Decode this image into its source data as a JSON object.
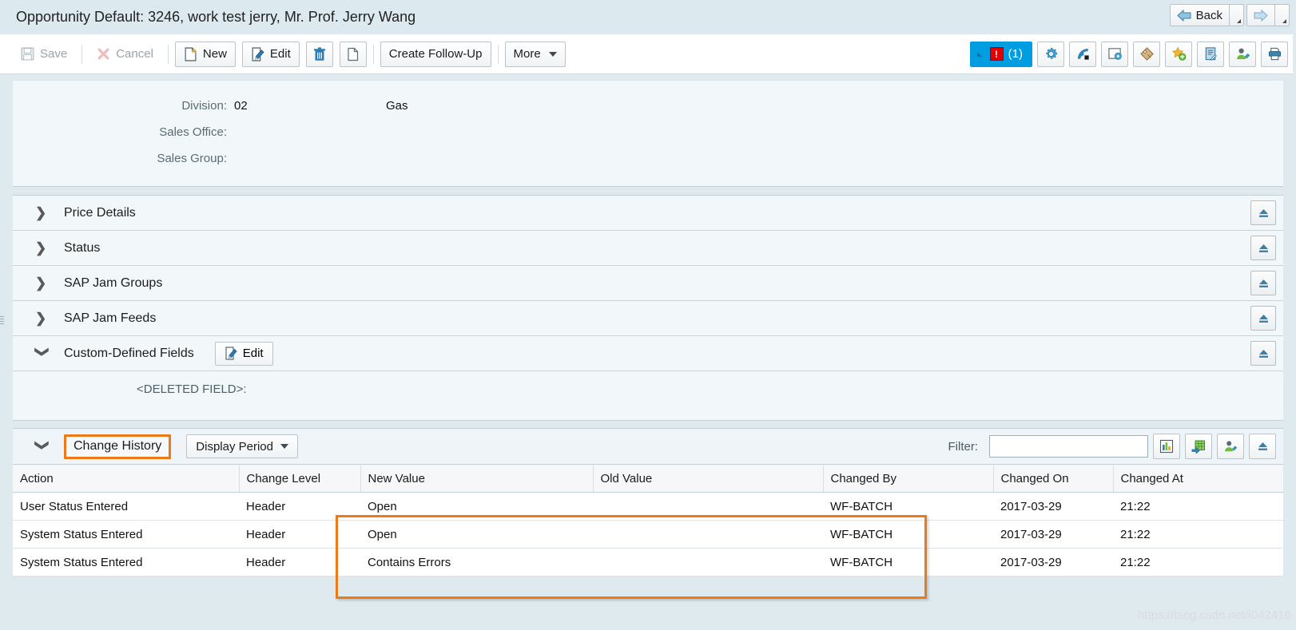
{
  "window": {
    "title": "Opportunity Default: 3246, work test jerry, Mr. Prof. Jerry Wang",
    "back_label": "Back"
  },
  "toolbar": {
    "save_label": "Save",
    "cancel_label": "Cancel",
    "new_label": "New",
    "edit_label": "Edit",
    "delete_icon": "trash-icon",
    "copy_icon": "copy-icon",
    "create_follow_up_label": "Create Follow-Up",
    "more_label": "More",
    "message_count": "(1)",
    "message_badge": "!",
    "right_icons": [
      "personalize-gear-icon",
      "web-feed-icon",
      "screen-configuration-icon",
      "tag-icon",
      "add-to-favorites-icon",
      "notes-icon",
      "assign-user-icon",
      "print-icon"
    ]
  },
  "details": {
    "rows": [
      {
        "label": "Division:",
        "value": "02",
        "value2": "Gas"
      },
      {
        "label": "Sales Office:",
        "value": "",
        "value2": ""
      },
      {
        "label": "Sales Group:",
        "value": "",
        "value2": ""
      }
    ]
  },
  "sections": [
    {
      "title": "Price Details",
      "expanded": false
    },
    {
      "title": "Status",
      "expanded": false
    },
    {
      "title": "SAP Jam Groups",
      "expanded": false
    },
    {
      "title": "SAP Jam Feeds",
      "expanded": false
    },
    {
      "title": "Custom-Defined Fields",
      "expanded": true,
      "edit_label": "Edit"
    }
  ],
  "custom_defined_fields": {
    "deleted_field_label": "<DELETED FIELD>:"
  },
  "change_history": {
    "title": "Change History",
    "display_period_label": "Display Period",
    "filter_label": "Filter:",
    "filter_value": "",
    "filter_placeholder": "",
    "toolbar_icons": [
      "chart-view-icon",
      "export-to-spreadsheet-icon",
      "assign-user-icon",
      "personalize-eject-icon"
    ],
    "columns": [
      "Action",
      "Change Level",
      "New Value",
      "Old Value",
      "Changed By",
      "Changed On",
      "Changed At"
    ],
    "rows": [
      {
        "action": "User Status Entered",
        "change_level": "Header",
        "new_value": "Open",
        "old_value": "",
        "changed_by": "WF-BATCH",
        "changed_on": "2017-03-29",
        "changed_at": "21:22"
      },
      {
        "action": "System Status Entered",
        "change_level": "Header",
        "new_value": "Open",
        "old_value": "",
        "changed_by": "WF-BATCH",
        "changed_on": "2017-03-29",
        "changed_at": "21:22"
      },
      {
        "action": "System Status Entered",
        "change_level": "Header",
        "new_value": "Contains Errors",
        "old_value": "",
        "changed_by": "WF-BATCH",
        "changed_on": "2017-03-29",
        "changed_at": "21:22"
      }
    ]
  },
  "annotations": {
    "highlight_color": "#ec7a18"
  },
  "watermark": {
    "text": "https://blog.csdn.net/i042416"
  }
}
